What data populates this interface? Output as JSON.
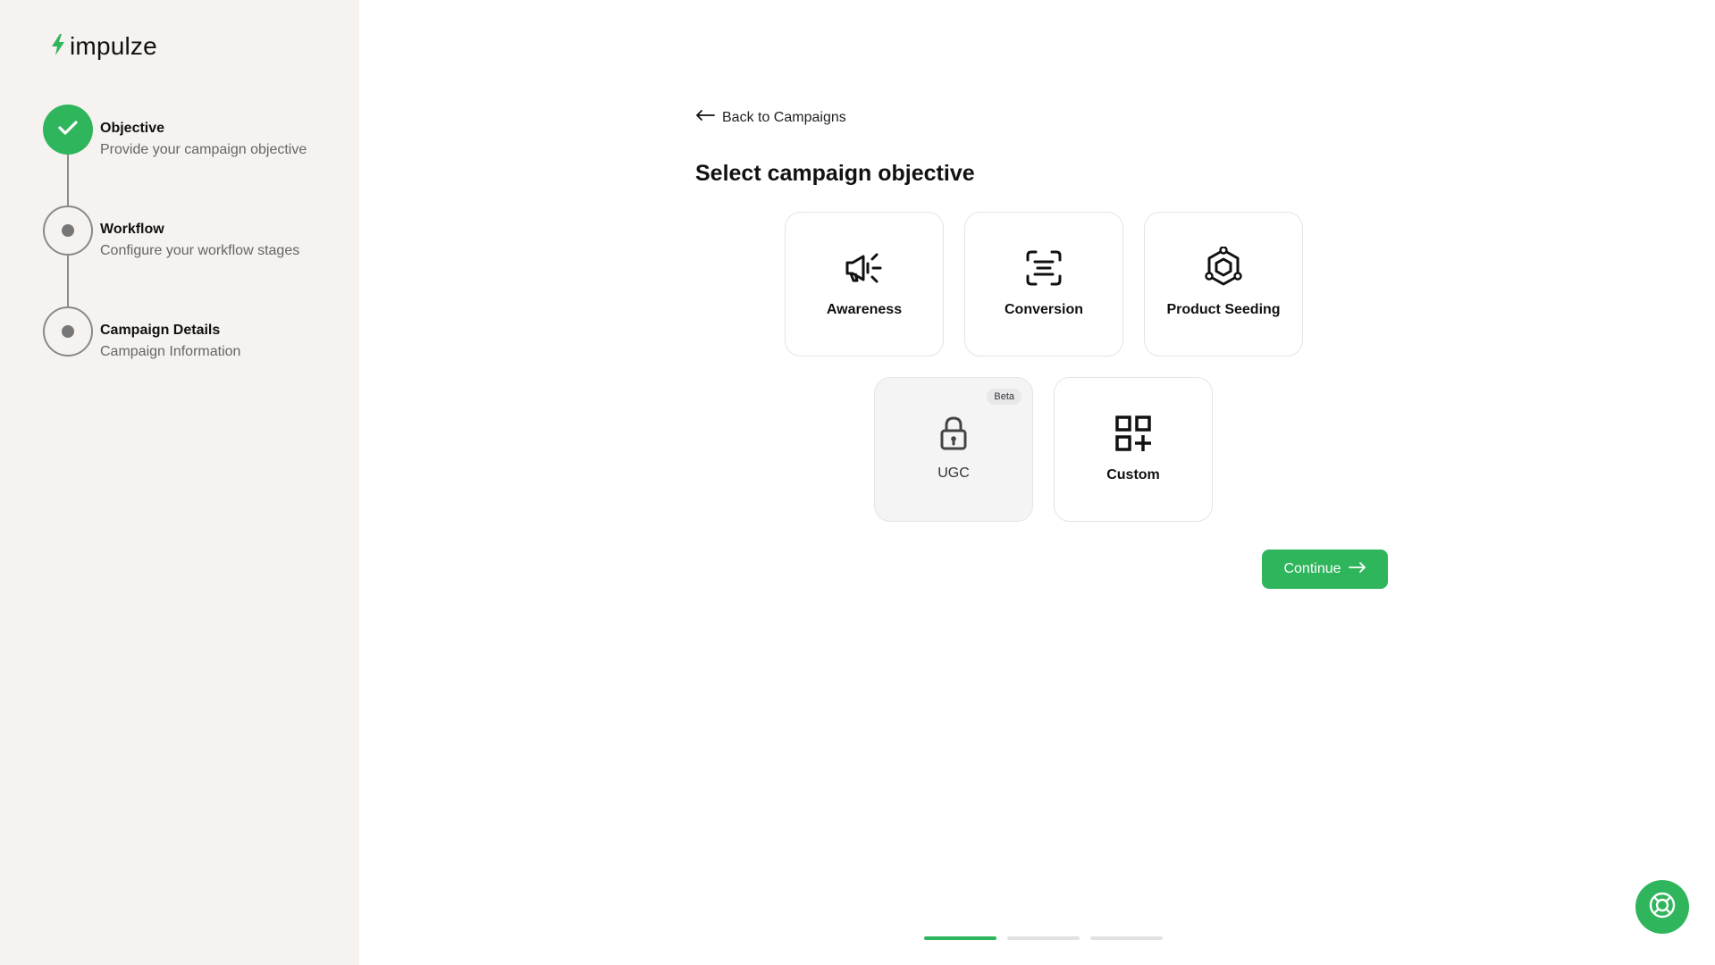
{
  "app": {
    "logo_text": "impulze",
    "accent_color": "#2fb55c"
  },
  "steps": [
    {
      "title": "Objective",
      "description": "Provide your campaign objective",
      "status": "completed"
    },
    {
      "title": "Workflow",
      "description": "Configure your workflow stages",
      "status": "pending"
    },
    {
      "title": "Campaign Details",
      "description": "Campaign Information",
      "status": "pending"
    }
  ],
  "main": {
    "back_label": "Back to Campaigns",
    "title": "Select campaign objective",
    "objectives": [
      {
        "label": "Awareness",
        "icon": "megaphone-icon",
        "disabled": false
      },
      {
        "label": "Conversion",
        "icon": "scan-text-icon",
        "disabled": false
      },
      {
        "label": "Product Seeding",
        "icon": "hexagon-network-icon",
        "disabled": false
      },
      {
        "label": "UGC",
        "icon": "lock-icon",
        "disabled": true,
        "badge": "Beta"
      },
      {
        "label": "Custom",
        "icon": "grid-plus-icon",
        "disabled": false
      }
    ],
    "continue_label": "Continue"
  },
  "progress": {
    "total_steps": 3,
    "current_step": 1
  }
}
